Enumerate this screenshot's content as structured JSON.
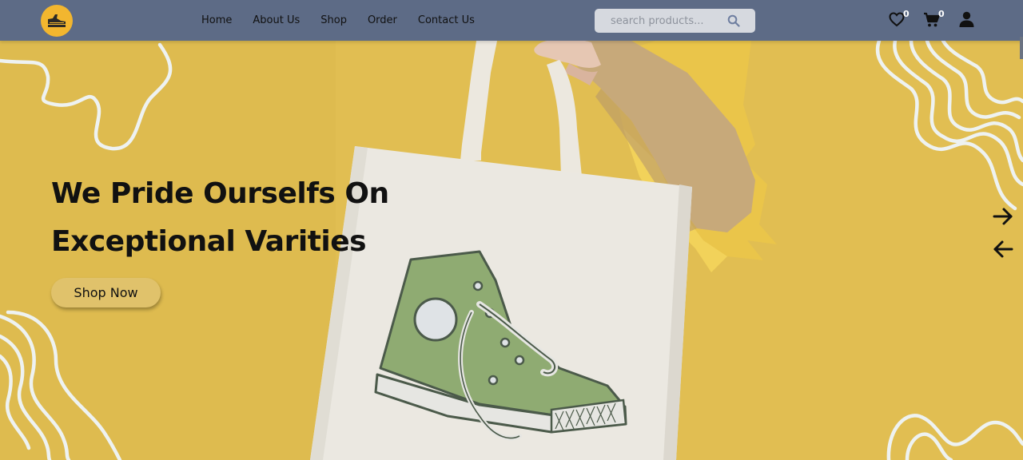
{
  "header": {
    "nav": [
      "Home",
      "About Us",
      "Shop",
      "Order",
      "Contact Us"
    ],
    "search": {
      "placeholder": "search products..."
    },
    "wishlist_count": "0",
    "cart_count": "0"
  },
  "hero": {
    "title_line1": "We Pride Ourselfs On",
    "title_line2": "Exceptional Varities",
    "cta_label": "Shop Now"
  },
  "icons": {
    "logo": "shoe-logo-icon",
    "search": "search-icon",
    "wishlist": "heart-icon",
    "cart": "cart-icon",
    "user": "user-icon",
    "next": "arrow-right-icon",
    "prev": "arrow-left-icon"
  },
  "colors": {
    "navbar": "#5d6b86",
    "hero_bg": "#e2bd4f",
    "logo_bg": "#f2b62f",
    "button_bg": "#e0c26b",
    "text": "#111111"
  }
}
